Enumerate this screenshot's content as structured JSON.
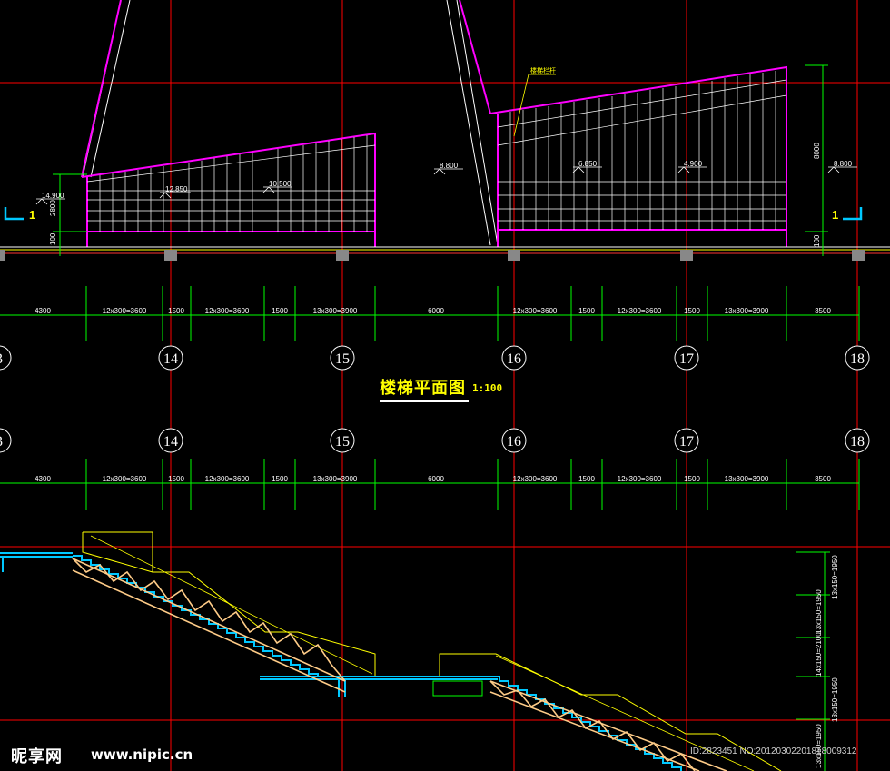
{
  "drawing": {
    "title": "楼梯平面图",
    "scale": "1:100",
    "colors": {
      "background": "#000000",
      "axis_grid": "#ff0000",
      "dimension": "#00ff00",
      "outline": "#ff00ff",
      "text": "#ffffff",
      "yellow": "#ffff00",
      "cyan": "#00c8ff",
      "truss": "#ffcc88"
    }
  },
  "plan": {
    "stair_label": "楼梯栏杆",
    "elevations": [
      "14.900",
      "12.850",
      "10.500",
      "8.800",
      "6.850",
      "4.900",
      "8.800"
    ],
    "left_vertical_dims": [
      "2800",
      "100"
    ],
    "right_vertical_dims": [
      "8000",
      "100"
    ],
    "section_marks": [
      "1",
      "1"
    ]
  },
  "dimension_rows": [
    {
      "segments": [
        "4300",
        "12x300=3600",
        "1500",
        "12x300=3600",
        "1500",
        "13x300=3900",
        "6000",
        "12x300=3600",
        "1500",
        "12x300=3600",
        "1500",
        "13x300=3900",
        "3500"
      ]
    },
    {
      "segments": [
        "4300",
        "12x300=3600",
        "1500",
        "12x300=3600",
        "1500",
        "13x300=3900",
        "6000",
        "12x300=3600",
        "1500",
        "12x300=3600",
        "1500",
        "13x300=3900",
        "3500"
      ]
    }
  ],
  "axes": {
    "row1": [
      "3",
      "14",
      "15",
      "16",
      "17",
      "18"
    ],
    "row2": [
      "3",
      "14",
      "15",
      "16",
      "17",
      "18"
    ]
  },
  "section": {
    "right_dims": [
      "13x150=1950",
      "13x150=1950",
      "14x150=2100",
      "13x150=1950",
      "13x150=1950"
    ]
  },
  "watermark": {
    "brand": "昵享网",
    "url": "www.nipic.cn",
    "id_text": "ID:2823451 NO:20120302201818009312"
  }
}
